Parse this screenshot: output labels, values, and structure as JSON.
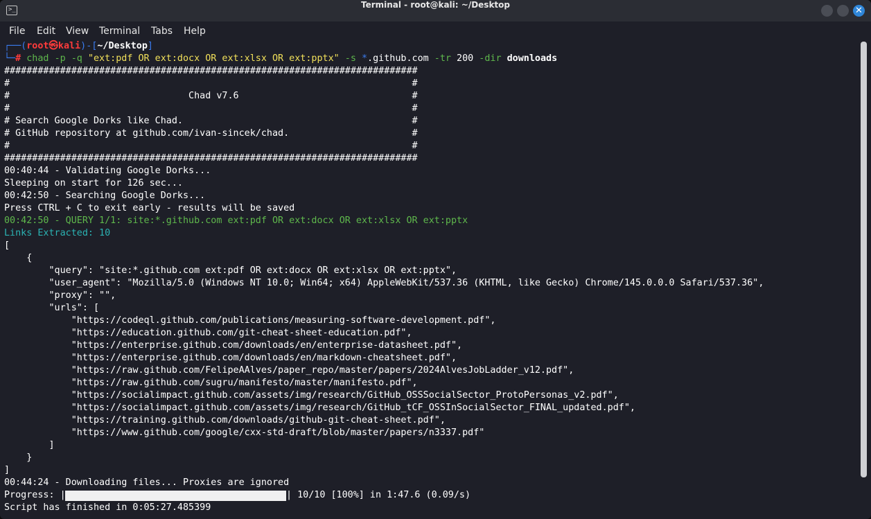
{
  "window": {
    "title": "Terminal - root@kali: ~/Desktop",
    "app_icon": ">_",
    "close_glyph": "✕"
  },
  "menu": [
    "File",
    "Edit",
    "View",
    "Terminal",
    "Tabs",
    "Help"
  ],
  "prompt": {
    "line1_a": "┌──(",
    "user": "root㉿kali",
    "line1_b": ")-[",
    "path": "~/Desktop",
    "line1_c": "]",
    "line2_a": "└─",
    "hash": "#",
    "cmd": "chad",
    "args1": "-p -q",
    "query": "\"ext:pdf OR ext:docx OR ext:xlsx OR ext:pptx\"",
    "args2": "-s",
    "star": "*",
    "site": ".github.com",
    "args3": "-tr",
    "tr_val": "200",
    "args4": "-dir",
    "dir_val": "downloads"
  },
  "banner": [
    "##########################################################################",
    "#                                                                        #",
    "#                                Chad v7.6                               #",
    "#                                                                        #",
    "# Search Google Dorks like Chad.                                         #",
    "# GitHub repository at github.com/ivan-sincek/chad.                      #",
    "#                                                                        #",
    "##########################################################################"
  ],
  "log": [
    "00:40:44 - Validating Google Dorks...",
    "Sleeping on start for 126 sec...",
    "00:42:50 - Searching Google Dorks...",
    "Press CTRL + C to exit early - results will be saved"
  ],
  "query_line": "00:42:50 - QUERY 1/1: site:*.github.com ext:pdf OR ext:docx OR ext:xlsx OR ext:pptx",
  "links_line": "Links Extracted: 10",
  "json_lines": [
    "[",
    "    {",
    "        \"query\": \"site:*.github.com ext:pdf OR ext:docx OR ext:xlsx OR ext:pptx\",",
    "        \"user_agent\": \"Mozilla/5.0 (Windows NT 10.0; Win64; x64) AppleWebKit/537.36 (KHTML, like Gecko) Chrome/145.0.0.0 Safari/537.36\",",
    "        \"proxy\": \"\",",
    "        \"urls\": [",
    "            \"https://codeql.github.com/publications/measuring-software-development.pdf\",",
    "            \"https://education.github.com/git-cheat-sheet-education.pdf\",",
    "            \"https://enterprise.github.com/downloads/en/enterprise-datasheet.pdf\",",
    "            \"https://enterprise.github.com/downloads/en/markdown-cheatsheet.pdf\",",
    "            \"https://raw.github.com/FelipeAAlves/paper_repo/master/papers/2024AlvesJobLadder_v12.pdf\",",
    "            \"https://raw.github.com/sugru/manifesto/master/manifesto.pdf\",",
    "            \"https://socialimpact.github.com/assets/img/research/GitHub_OSSSocialSector_ProtoPersonas_v2.pdf\",",
    "            \"https://socialimpact.github.com/assets/img/research/GitHub_tCF_OSSInSocialSector_FINAL_updated.pdf\",",
    "            \"https://training.github.com/downloads/github-git-cheat-sheet.pdf\",",
    "            \"https://www.github.com/google/cxx-std-draft/blob/master/papers/n3337.pdf\"",
    "        ]",
    "    }",
    "]"
  ],
  "download_line": "00:44:24 - Downloading files... Proxies are ignored",
  "progress": {
    "label": "Progress: |",
    "fraction": 1.0,
    "suffix": "| 10/10 [100%] in 1:47.6 (0.09/s)"
  },
  "finish_line": "Script has finished in 0:05:27.485399"
}
